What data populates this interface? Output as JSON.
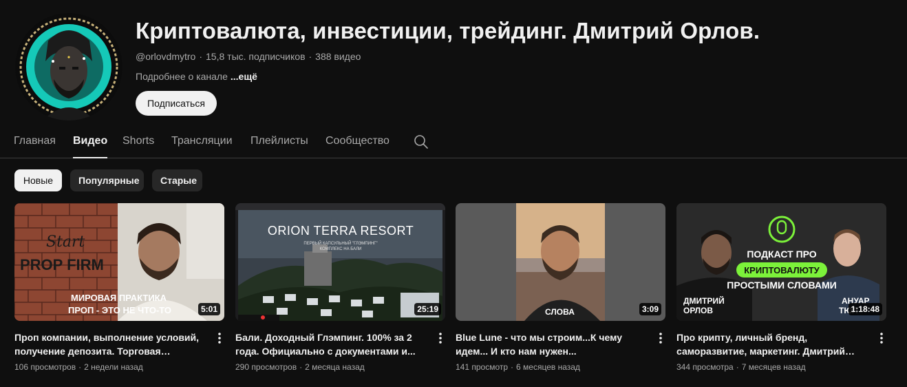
{
  "channel": {
    "title": "Криптовалюта, инвестиции, трейдинг. Дмитрий Орлов.",
    "handle": "@orlovdmytro",
    "subscribers": "15,8 тыс. подписчиков",
    "video_count": "388 видео",
    "separator": "·",
    "about": "Подробнее о канале",
    "about_more": "...ещё",
    "subscribe_label": "Подписаться"
  },
  "tabs": [
    {
      "label": "Главная",
      "active": false
    },
    {
      "label": "Видео",
      "active": true
    },
    {
      "label": "Shorts",
      "active": false
    },
    {
      "label": "Трансляции",
      "active": false
    },
    {
      "label": "Плейлисты",
      "active": false
    },
    {
      "label": "Сообщество",
      "active": false
    }
  ],
  "search_icon": "search-icon",
  "chips": [
    {
      "label": "Новые",
      "selected": true
    },
    {
      "label": "Популярные",
      "selected": false
    },
    {
      "label": "Старые",
      "selected": false
    }
  ],
  "videos": [
    {
      "title": "Проп компании, выполнение условий, получение депозита. Торговая стратегия...",
      "views": "106 просмотров",
      "age": "2 недели назад",
      "duration": "5:01",
      "thumb_text": [
        "Start",
        "PROP FIRM",
        "МИРОВАЯ ПРАКТИКА",
        "ПРОП - ЭТО НЕ ЧТО-ТО"
      ]
    },
    {
      "title": "Бали. Доходный Глэмпинг. 100% за 2 года. Официально с документами и...",
      "views": "290 просмотров",
      "age": "2 месяца назад",
      "duration": "25:19",
      "thumb_text": [
        "ORION TERRA RESORT",
        "ПЕРВЫЙ КАПСУЛЬНЫЙ \"ГЛЭМПИНГ\"",
        "КОМПЛЕКС НА БАЛИ"
      ]
    },
    {
      "title": "Blue Lune - что мы строим...К чему идем... И кто нам нужен...",
      "views": "141 просмотр",
      "age": "6 месяцев назад",
      "duration": "3:09",
      "thumb_text": [
        "СЛОВА"
      ]
    },
    {
      "title": "Про крипту, личный бренд, саморазвитие, маркетинг. Дмитрий Орлов.",
      "views": "344 просмотра",
      "age": "7 месяцев назад",
      "duration": "1:18:48",
      "thumb_text": [
        "ПОДКАСТ ПРО",
        "КРИПТОВАЛЮТУ",
        "ПРОСТЫМИ СЛОВАМИ",
        "ДМИТРИЙ",
        "ОРЛОВ",
        "АНУАР",
        "ТЮЛ"
      ]
    }
  ],
  "colors": {
    "background": "#0f0f0f",
    "text": "#f1f1f1",
    "muted": "#aaaaaa",
    "chip": "#272727",
    "accent_green": "#7cf23a",
    "teal": "#15c9b8"
  }
}
